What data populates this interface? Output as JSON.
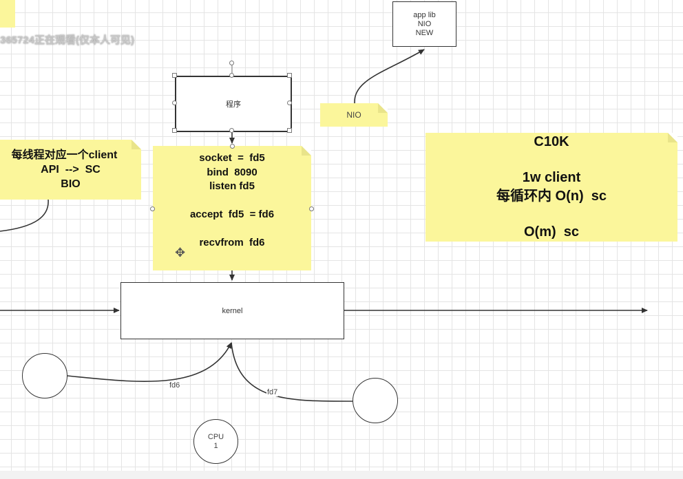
{
  "overlay_text": "365724正在观看(仅本人可见)",
  "app_box": {
    "lines": [
      "app  lib",
      "NIO",
      "NEW"
    ]
  },
  "nio_note": {
    "label": "NIO"
  },
  "program_box": {
    "label": "程序"
  },
  "left_note": {
    "lines": [
      "每线程对应一个client",
      "API  -->  SC",
      "BIO"
    ]
  },
  "center_note": {
    "lines": [
      "socket  =  fd5",
      "bind  8090",
      "listen fd5",
      "",
      "accept  fd5  = fd6",
      "",
      "recvfrom  fd6"
    ]
  },
  "c10k_note": {
    "lines": [
      "C10K",
      "",
      "1w client",
      "每循环内 O(n)  sc",
      "",
      "O(m)  sc"
    ]
  },
  "kernel_box": {
    "label": "kernel"
  },
  "edge_labels": {
    "fd6": "fd6",
    "fd7": "fd7"
  },
  "cpu": {
    "lines": [
      "CPU",
      "1"
    ]
  },
  "colors": {
    "note": "#fbf69b",
    "stroke": "#333333",
    "grid": "#e4e4e4"
  }
}
